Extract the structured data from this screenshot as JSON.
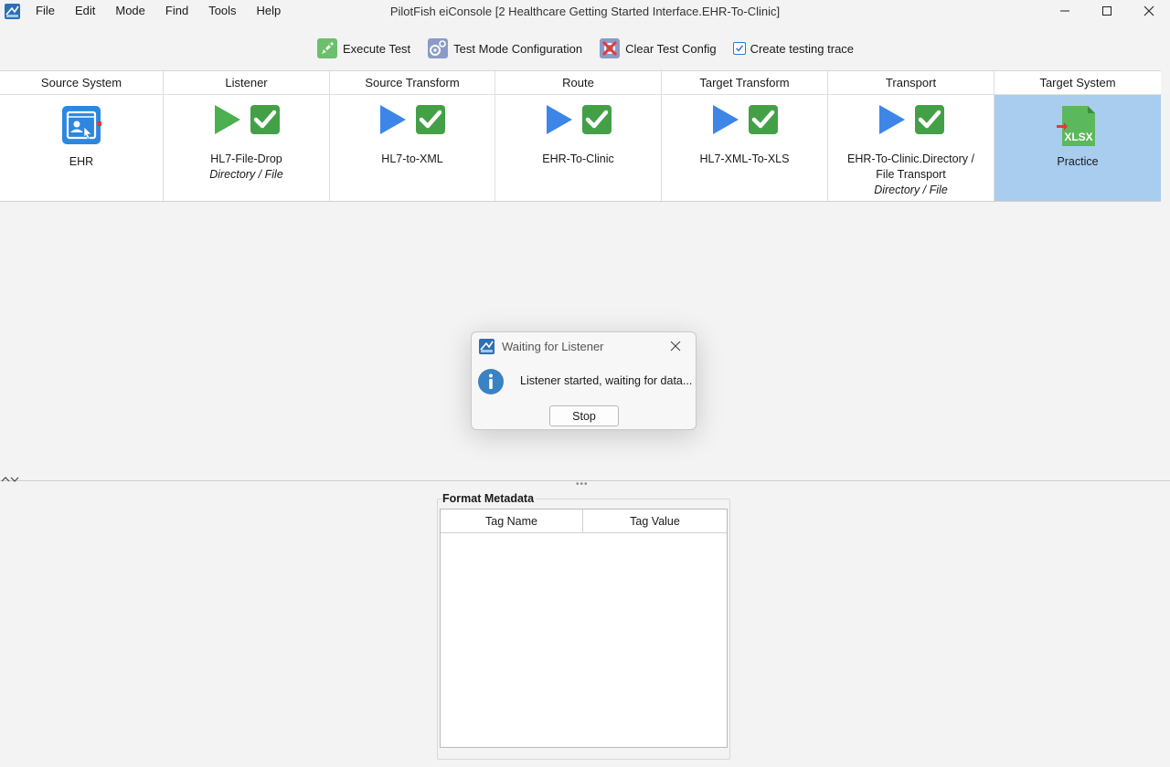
{
  "window": {
    "title": "PilotFish eiConsole [2 Healthcare Getting Started Interface.EHR-To-Clinic]"
  },
  "menu": [
    "File",
    "Edit",
    "Mode",
    "Find",
    "Tools",
    "Help"
  ],
  "toolbar": {
    "execute_test": "Execute Test",
    "test_mode_config": "Test Mode Configuration",
    "clear_test_config": "Clear Test Config",
    "create_trace": "Create testing trace",
    "create_trace_checked": true
  },
  "stages": [
    {
      "header": "Source System",
      "label": "EHR",
      "sub": "",
      "icon": "ehr-app-icon"
    },
    {
      "header": "Listener",
      "label": "HL7-File-Drop",
      "sub": "Directory / File",
      "icon": "play-check-icons"
    },
    {
      "header": "Source Transform",
      "label": "HL7-to-XML",
      "sub": "",
      "icon": "play-check-icons"
    },
    {
      "header": "Route",
      "label": "EHR-To-Clinic",
      "sub": "",
      "icon": "play-check-icons"
    },
    {
      "header": "Target Transform",
      "label": "HL7-XML-To-XLS",
      "sub": "",
      "icon": "play-check-icons"
    },
    {
      "header": "Transport",
      "label": "EHR-To-Clinic.Directory /",
      "label2": "File Transport",
      "sub": "Directory / File",
      "icon": "play-check-icons"
    },
    {
      "header": "Target System",
      "label": "Practice",
      "sub": "",
      "icon": "xlsx-file-icon",
      "icon_text": "XLSX",
      "selected": true
    }
  ],
  "metadata": {
    "title": "Format Metadata",
    "columns": [
      "Tag Name",
      "Tag Value"
    ]
  },
  "dialog": {
    "title": "Waiting for Listener",
    "message": "Listener started, waiting for data...",
    "stop_label": "Stop"
  },
  "colors": {
    "play_blue": "#3d86e8",
    "play_green": "#4caf50",
    "check_green": "#43a047",
    "selected": "#a8cdee",
    "xlsx_green": "#5cb85c"
  }
}
